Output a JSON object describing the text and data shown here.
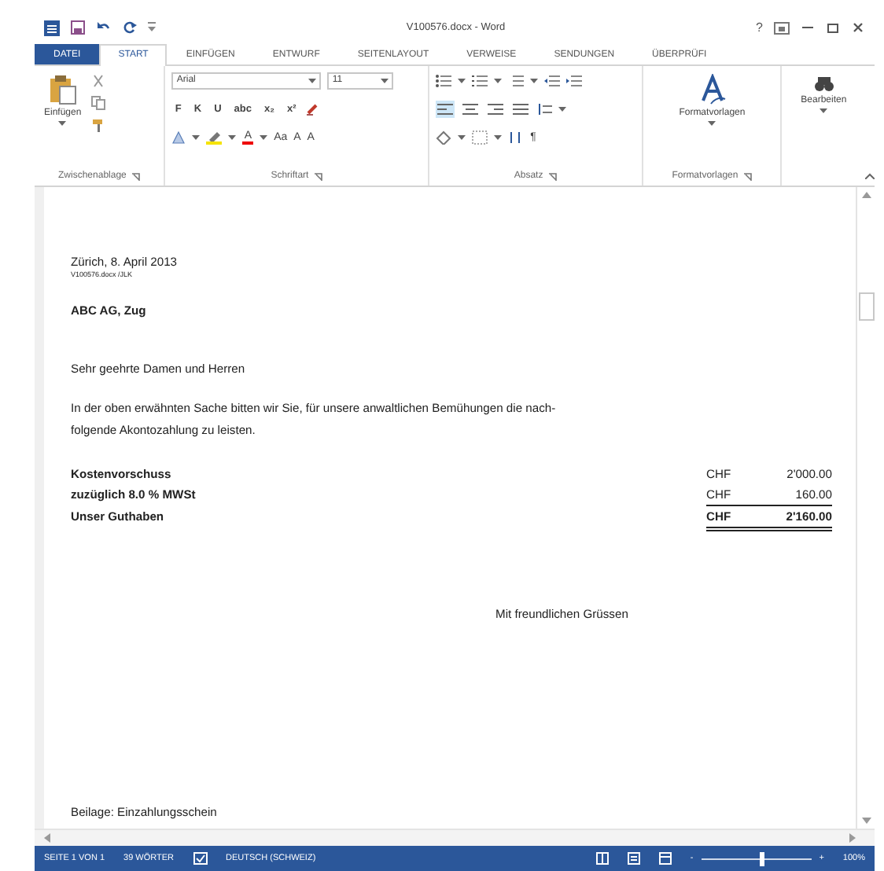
{
  "window": {
    "title": "V100576.docx - Word",
    "help": "?"
  },
  "tabs": [
    {
      "label": "DATEI",
      "kind": "file",
      "selected": false
    },
    {
      "label": "START",
      "kind": "tab",
      "selected": true
    },
    {
      "label": "EINFÜGEN",
      "kind": "tab",
      "selected": false
    },
    {
      "label": "ENTWURF",
      "kind": "tab",
      "selected": false
    },
    {
      "label": "SEITENLAYOUT",
      "kind": "tab",
      "selected": false
    },
    {
      "label": "VERWEISE",
      "kind": "tab",
      "selected": false
    },
    {
      "label": "SENDUNGEN",
      "kind": "tab",
      "selected": false
    },
    {
      "label": "ÜBERPRÜFI",
      "kind": "tab",
      "selected": false
    }
  ],
  "ribbon": {
    "clipboard": {
      "label": "Zwischenablage",
      "paste": "Einfügen"
    },
    "font": {
      "label": "Schriftart",
      "font": "Arial",
      "size": "11",
      "format_buttons": [
        "F",
        "K",
        "U",
        "abc",
        "x₂",
        "x²"
      ],
      "color_letter": "A",
      "case": "Aa",
      "grow_shrink": [
        "A",
        "A"
      ]
    },
    "paragraph": {
      "label": "Absatz",
      "pilcrow": "¶",
      "alignment_buttons": [
        {
          "selected": true
        },
        {
          "selected": false
        },
        {
          "selected": false
        },
        {
          "selected": false
        }
      ]
    },
    "styles": {
      "label": "Formatvorlagen",
      "button": "Formatvorlagen"
    },
    "editing": {
      "button": "Bearbeiten"
    }
  },
  "document": {
    "date": "Zürich, 8. April 2013",
    "reference": "V100576.docx /JLK",
    "recipient": "ABC AG, Zug",
    "salutation": "Sehr geehrte Damen und Herren",
    "body_lines": [
      "In der oben erwähnten Sache bitten wir Sie, für unsere anwaltlichen Bemühungen die nach-",
      "folgende Akontozahlung zu leisten."
    ],
    "items": [
      {
        "label": "Kostenvorschuss",
        "currency": "CHF",
        "amount": "2'000.00",
        "kind": "plain"
      },
      {
        "label": "zuzüglich 8.0 % MWSt",
        "currency": "CHF",
        "amount": "160.00",
        "kind": "subtotal"
      },
      {
        "label": "Unser Guthaben",
        "currency": "CHF",
        "amount": "2'160.00",
        "kind": "total"
      }
    ],
    "closing": "Mit freundlichen Grüssen",
    "enclosure": "Beilage: Einzahlungsschein"
  },
  "status_bar": {
    "page": "SEITE 1 VON 1",
    "words": "39 WÖRTER",
    "language": "DEUTSCH (SCHWEIZ)",
    "zoom_out": "-",
    "zoom_in": "+",
    "zoom": "100%",
    "level": 0.55
  }
}
